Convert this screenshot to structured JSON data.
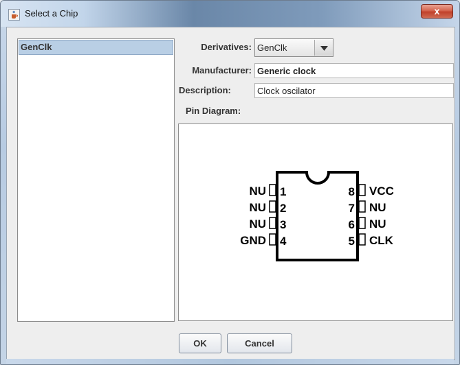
{
  "window": {
    "title": "Select a Chip",
    "close_symbol": "x"
  },
  "chip_list": {
    "items": [
      "GenClk"
    ],
    "selected": "GenClk"
  },
  "form": {
    "derivatives_label": "Derivatives:",
    "derivatives_value": "GenClk",
    "manufacturer_label": "Manufacturer:",
    "manufacturer_value": "Generic clock",
    "description_label": "Description:",
    "description_value": "Clock oscilator",
    "pin_diagram_label": "Pin Diagram:"
  },
  "pin_diagram": {
    "left_pins": [
      {
        "name": "NU",
        "number": "1"
      },
      {
        "name": "NU",
        "number": "2"
      },
      {
        "name": "NU",
        "number": "3"
      },
      {
        "name": "GND",
        "number": "4"
      }
    ],
    "right_pins": [
      {
        "name": "VCC",
        "number": "8"
      },
      {
        "name": "NU",
        "number": "7"
      },
      {
        "name": "NU",
        "number": "6"
      },
      {
        "name": "CLK",
        "number": "5"
      }
    ]
  },
  "buttons": {
    "ok": "OK",
    "cancel": "Cancel"
  },
  "icons": {
    "app": "java-cup-icon",
    "dropdown": "triangle-down-icon",
    "close": "close-icon"
  }
}
